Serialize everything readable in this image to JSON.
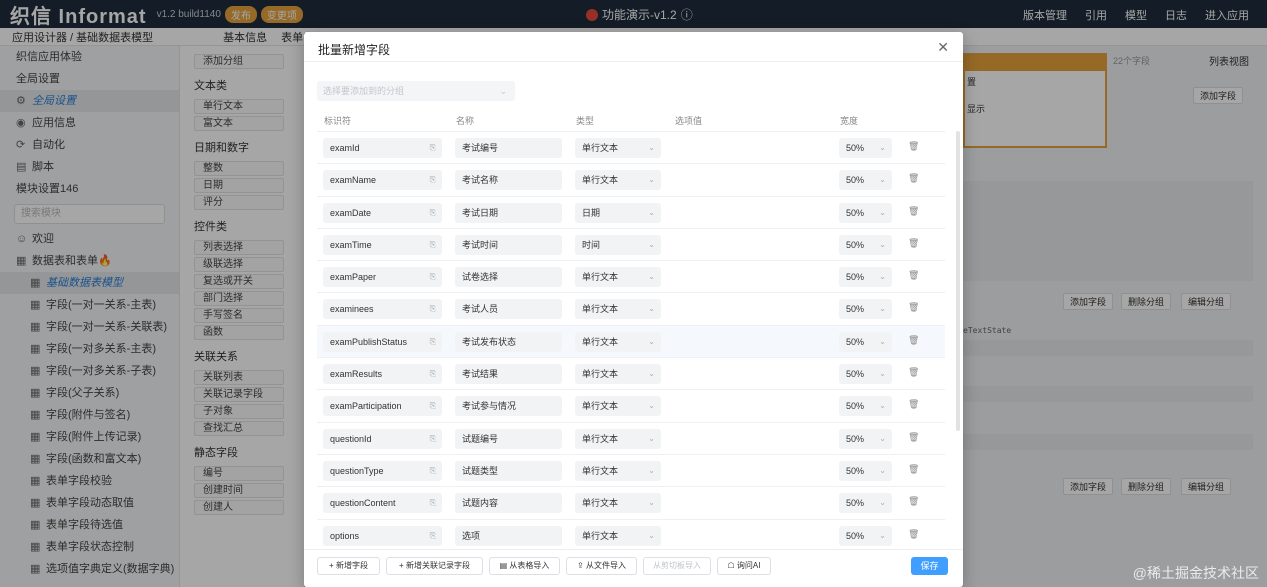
{
  "topbar": {
    "logo": "织信 Informat",
    "version": "v1.2 build1140",
    "badge_publish": "发布",
    "badge_changes": "变更项",
    "title": "功能演示-v1.2",
    "actions": [
      "版本管理",
      "引用",
      "模型",
      "日志",
      "进入应用"
    ]
  },
  "subbar": {
    "breadcrumb": "应用设计器 / 基础数据表模型",
    "tabs": [
      "基本信息",
      "表单字段"
    ]
  },
  "sidebar": {
    "section_top": "织信应用体验",
    "global": "全局设置",
    "items_top": [
      "全局设置",
      "应用信息",
      "自动化",
      "脚本"
    ],
    "module_label": "模块设置146",
    "search_placeholder": "搜索模块",
    "welcome": "欢迎",
    "group": "数据表和表单🔥",
    "models": [
      "基础数据表模型",
      "字段(一对一关系-主表)",
      "字段(一对一关系-关联表)",
      "字段(一对多关系-主表)",
      "字段(一对多关系-子表)",
      "字段(父子关系)",
      "字段(附件与签名)",
      "字段(附件上传记录)",
      "字段(函数和富文本)",
      "表单字段校验",
      "表单字段动态取值",
      "表单字段待选值",
      "表单字段状态控制",
      "选项值字典定义(数据字典)"
    ]
  },
  "palette": {
    "add_group": "添加分组",
    "sections": [
      {
        "title": "文本类",
        "items": [
          "单行文本",
          "富文本"
        ]
      },
      {
        "title": "日期和数字",
        "items": [
          "整数",
          "日期",
          "评分"
        ]
      },
      {
        "title": "控件类",
        "items": [
          "列表选择",
          "级联选择",
          "复选或开关",
          "部门选择",
          "手写签名",
          "函数"
        ]
      },
      {
        "title": "关联关系",
        "items": [
          "关联列表",
          "关联记录字段",
          "子对象",
          "查找汇总"
        ]
      },
      {
        "title": "静态字段",
        "items": [
          "编号",
          "创建时间",
          "创建人"
        ]
      }
    ]
  },
  "background": {
    "field_count": "22个字段",
    "list_view": "列表视图",
    "add_field": "添加字段",
    "delete_group": "删除分组",
    "edit_group": "编辑分组",
    "code_hint": "eTextState",
    "card_lines": [
      "置",
      "显示"
    ]
  },
  "modal": {
    "title": "批量新增字段",
    "group_placeholder": "选择要添加到的分组",
    "headers": {
      "id": "标识符",
      "name": "名称",
      "type": "类型",
      "options": "选项值",
      "width": "宽度"
    },
    "rows": [
      {
        "id": "examId",
        "name": "考试编号",
        "type": "单行文本",
        "width": "50%"
      },
      {
        "id": "examName",
        "name": "考试名称",
        "type": "单行文本",
        "width": "50%"
      },
      {
        "id": "examDate",
        "name": "考试日期",
        "type": "日期",
        "width": "50%"
      },
      {
        "id": "examTime",
        "name": "考试时间",
        "type": "时间",
        "width": "50%"
      },
      {
        "id": "examPaper",
        "name": "试卷选择",
        "type": "单行文本",
        "width": "50%"
      },
      {
        "id": "examinees",
        "name": "考试人员",
        "type": "单行文本",
        "width": "50%"
      },
      {
        "id": "examPublishStatus",
        "name": "考试发布状态",
        "type": "单行文本",
        "width": "50%"
      },
      {
        "id": "examResults",
        "name": "考试结果",
        "type": "单行文本",
        "width": "50%"
      },
      {
        "id": "examParticipation",
        "name": "考试参与情况",
        "type": "单行文本",
        "width": "50%"
      },
      {
        "id": "questionId",
        "name": "试题编号",
        "type": "单行文本",
        "width": "50%"
      },
      {
        "id": "questionType",
        "name": "试题类型",
        "type": "单行文本",
        "width": "50%"
      },
      {
        "id": "questionContent",
        "name": "试题内容",
        "type": "单行文本",
        "width": "50%"
      },
      {
        "id": "options",
        "name": "选项",
        "type": "单行文本",
        "width": "50%"
      }
    ],
    "footer": {
      "add_field": "+ 新增字段",
      "add_relation": "+ 新增关联记录字段",
      "import_table": "从表格导入",
      "import_file": "从文件导入",
      "import_clipboard": "从剪切板导入",
      "ask_ai": "询问AI",
      "save": "保存"
    }
  },
  "watermark": "@稀土掘金技术社区"
}
